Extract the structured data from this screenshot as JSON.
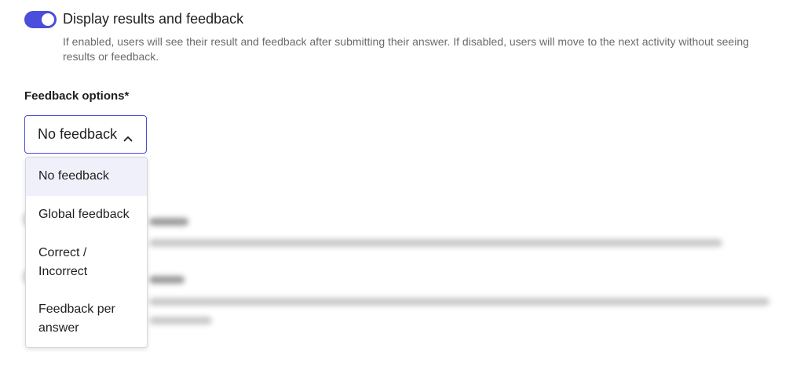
{
  "toggle": {
    "enabled": true,
    "title": "Display results and feedback",
    "description": "If enabled, users will see their result and feedback after submitting their answer. If disabled, users will move to the next activity without seeing results or feedback."
  },
  "feedback_options": {
    "label": "Feedback options*",
    "selected_value": "No feedback",
    "options": [
      {
        "label": "No feedback",
        "selected": true
      },
      {
        "label": "Global feedback",
        "selected": false
      },
      {
        "label": "Correct / Incorrect",
        "selected": false
      },
      {
        "label": "Feedback per answer",
        "selected": false
      }
    ]
  },
  "colors": {
    "accent": "#4b4ddb",
    "selected_item_bg": "#f0f0fb",
    "muted_text": "#6b6b6b"
  },
  "icons": {
    "dropdown": "chevron-up-icon"
  }
}
